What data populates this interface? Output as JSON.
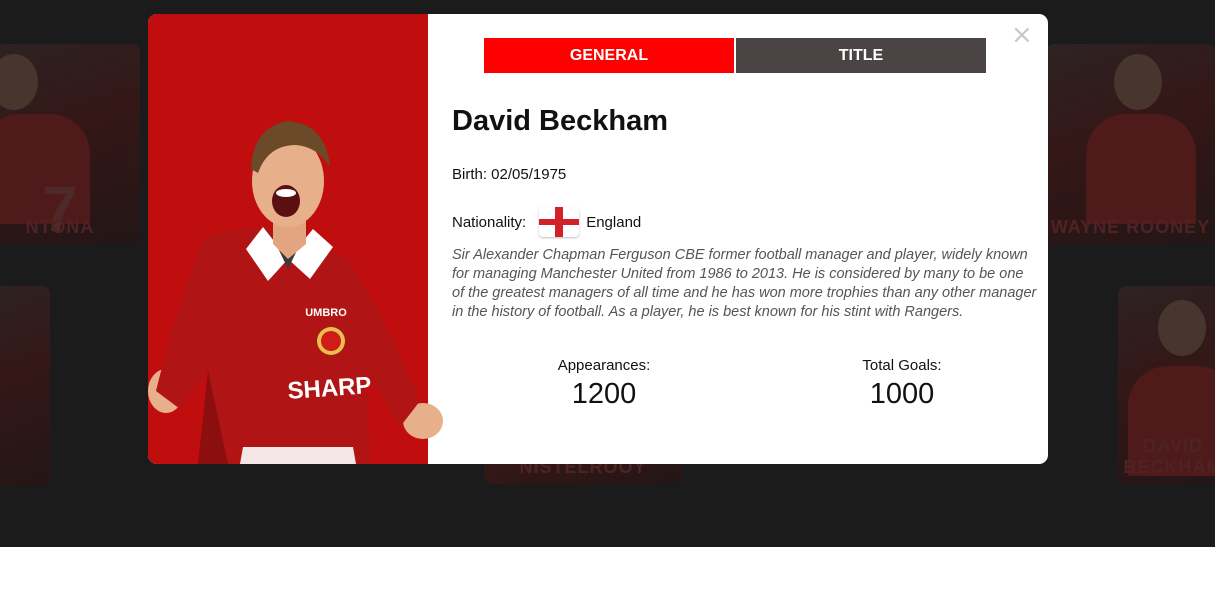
{
  "background_cards": [
    {
      "caption": "NTONA",
      "number": "7"
    },
    {
      "caption": "WAYNE ROONEY",
      "number": ""
    },
    {
      "caption": "NISTELROOY",
      "number": ""
    },
    {
      "caption": "DAVID BECKHAM",
      "number": ""
    }
  ],
  "modal": {
    "close_label": "×",
    "tabs": [
      {
        "label": "GENERAL",
        "active": true
      },
      {
        "label": "TITLE",
        "active": false
      }
    ],
    "player_name": "David Beckham",
    "birth": "Birth: 02/05/1975",
    "nationality_label": "Nationality:",
    "nationality_value": "England",
    "flag_icon": "england-flag-icon",
    "bio": "Sir Alexander Chapman Ferguson CBE former football manager and player, widely known for managing Manchester United from 1986 to 2013. He is considered by many to be one of the greatest managers of all time and he has won more trophies than any other manager in the history of football. As a player, he is best known for his stint with Rangers.",
    "stats": {
      "appearances_label": "Appearances:",
      "appearances_value": "1200",
      "goals_label": "Total Goals:",
      "goals_value": "1000"
    },
    "jersey": {
      "brand": "UMBRO",
      "sponsor": "SHARP"
    }
  },
  "colors": {
    "accent_red": "#ff0000",
    "panel_red": "#c00d0d",
    "tab_inactive": "#4a4444",
    "backdrop": "#1b1b1b"
  }
}
